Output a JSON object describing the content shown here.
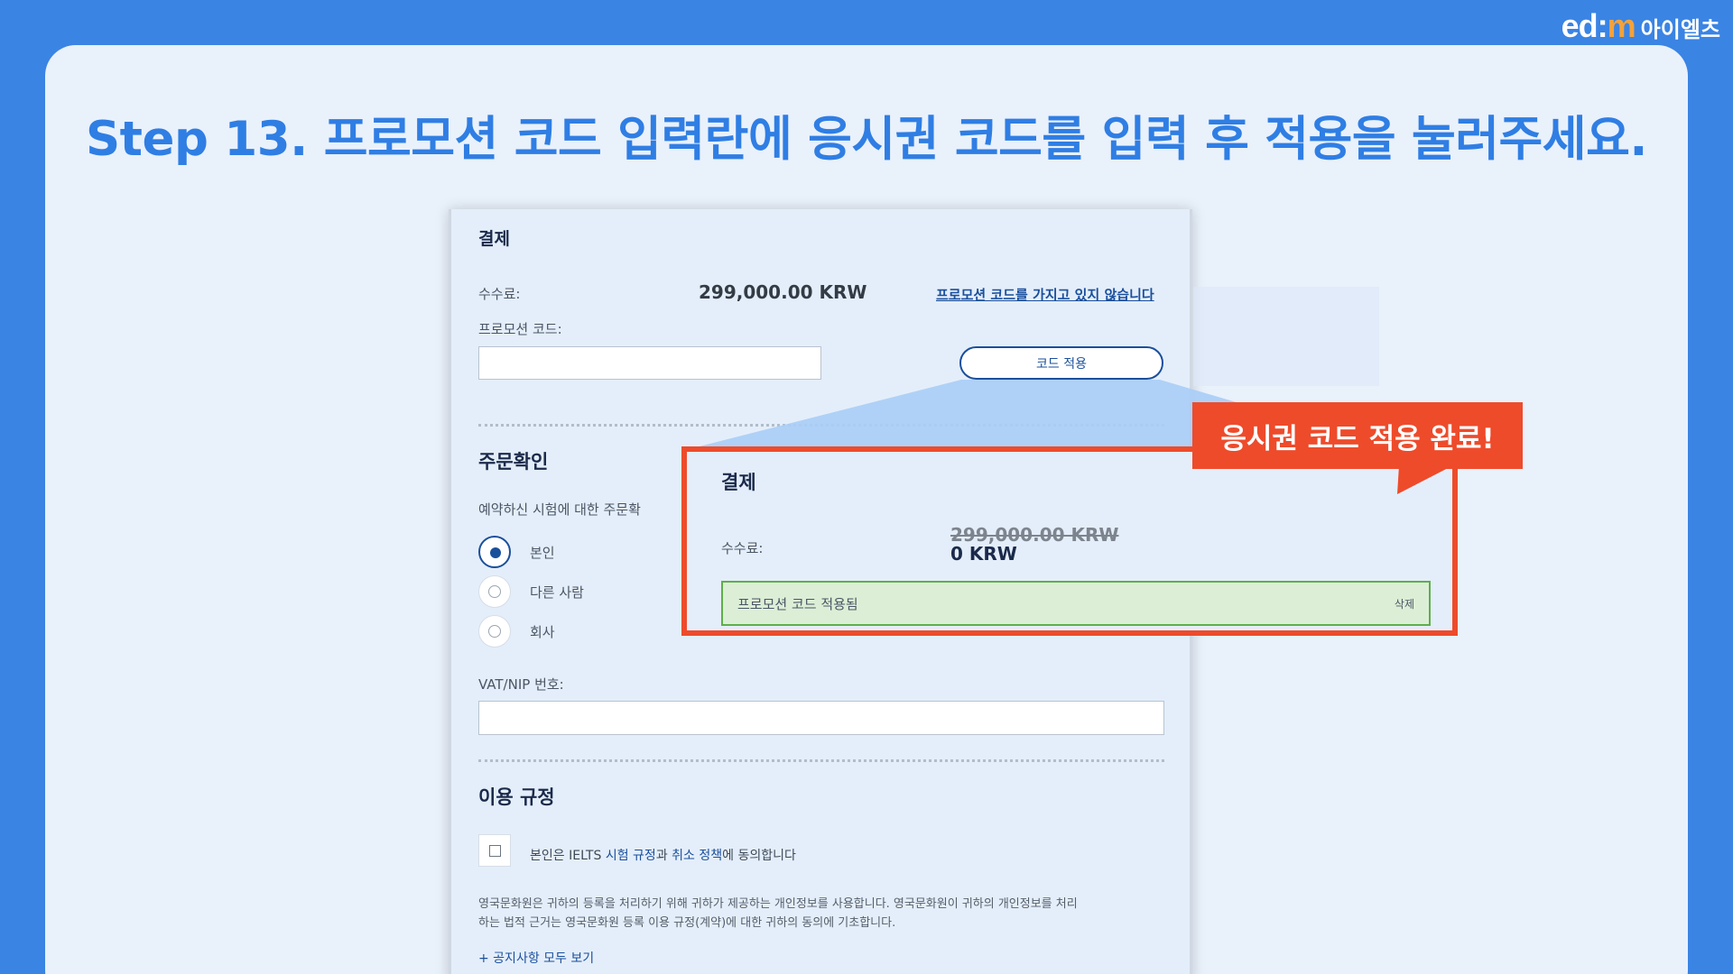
{
  "branding": {
    "logo_mark_a": "ed",
    "logo_mark_sep": ":",
    "logo_mark_b": "m",
    "logo_text": "아이엘츠"
  },
  "slide": {
    "title": "Step 13. 프로모션 코드 입력란에 응시권 코드를 입력 후 적용을 눌러주세요."
  },
  "payment": {
    "heading": "결제",
    "fee_label": "수수료:",
    "fee_value": "299,000.00 KRW",
    "no_code_link": "프로모션 코드를 가지고 있지 않습니다",
    "promo_label": "프로모션 코드:",
    "promo_value": "",
    "apply_button": "코드 적용"
  },
  "order": {
    "heading": "주문확인",
    "question": "예약하신 시험에 대한 주문확",
    "options": [
      {
        "label": "본인",
        "selected": true
      },
      {
        "label": "다른 사람",
        "selected": false
      },
      {
        "label": "회사",
        "selected": false
      }
    ],
    "vat_label": "VAT/NIP 번호:",
    "vat_value": ""
  },
  "terms": {
    "heading": "이용 규정",
    "agree_prefix": "본인은 IELTS ",
    "agree_link1": "시험 규정",
    "agree_mid": "과 ",
    "agree_link2": "취소 정책",
    "agree_suffix": "에 동의합니다",
    "notice_line1": "영국문화원은 귀하의 등록을 처리하기 위해 귀하가 제공하는 개인정보를 사용합니다. 영국문화원이 귀하의 개인정보를 처리",
    "notice_line2": "하는 법적 근거는 영국문화원 등록 이용 규정(계약)에 대한 귀하의 동의에 기초합니다.",
    "see_all": "+ 공지사항 모두 보기"
  },
  "zoom": {
    "heading": "결제",
    "fee_label": "수수료:",
    "old_value": "299,000.00 KRW",
    "new_value": "0 KRW",
    "applied_text": "프로모션 코드 적용됨",
    "delete_label": "삭제"
  },
  "callout": {
    "text": "응시권 코드 적용 완료!"
  },
  "colors": {
    "background": "#3a84e4",
    "title": "#2f7ee4",
    "highlight": "#ee4b2b",
    "applied_bg": "#dcefd6",
    "link": "#1a4f9c"
  }
}
